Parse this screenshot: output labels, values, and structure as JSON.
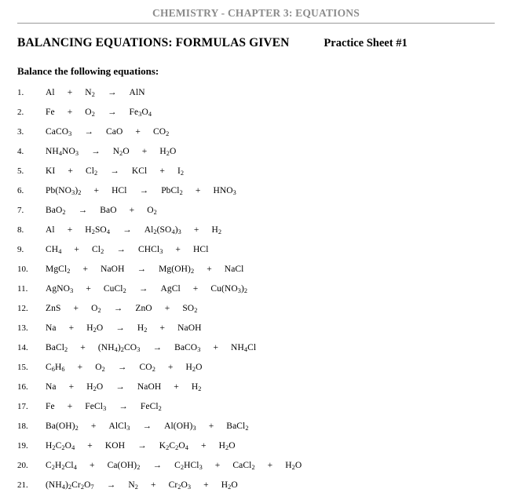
{
  "header": {
    "running_title": "CHEMISTRY - CHAPTER 3: EQUATIONS"
  },
  "title": {
    "main": "BALANCING EQUATIONS: FORMULAS GIVEN",
    "sheet": "Practice Sheet #1"
  },
  "instruction": "Balance the following equations:",
  "equations": [
    {
      "number": "1.",
      "reactants": [
        "Al",
        "N2"
      ],
      "products": [
        "AlN"
      ],
      "text": "Al  +  N2 →  AlN"
    },
    {
      "number": "2.",
      "reactants": [
        "Fe",
        "O2"
      ],
      "products": [
        "Fe3O4"
      ],
      "text": "Fe  +  O2  →  Fe3O4"
    },
    {
      "number": "3.",
      "reactants": [
        "CaCO3"
      ],
      "products": [
        "CaO",
        "CO2"
      ],
      "text": "CaCO3 →  CaO  +  CO2"
    },
    {
      "number": "4.",
      "reactants": [
        "NH4NO3"
      ],
      "products": [
        "N2O",
        "H2O"
      ],
      "text": "NH4NO3 →  N2O  +  H2O"
    },
    {
      "number": "5.",
      "reactants": [
        "KI",
        "Cl2"
      ],
      "products": [
        "KCl",
        "I2"
      ],
      "text": "KI  +  Cl2 →  KCl  +  I2"
    },
    {
      "number": "6.",
      "reactants": [
        "Pb(NO3)2",
        "HCl"
      ],
      "products": [
        "PbCl2",
        "HNO3"
      ],
      "text": "Pb(NO3)2 +  HCl →  PbCl2  +  HNO3"
    },
    {
      "number": "7.",
      "reactants": [
        "BaO2"
      ],
      "products": [
        "BaO",
        "O2"
      ],
      "text": "BaO2 →  BaO  +  O2"
    },
    {
      "number": "8.",
      "reactants": [
        "Al",
        "H2SO4"
      ],
      "products": [
        "Al2(SO4)3",
        "H2"
      ],
      "text": "Al  +  H2SO4 →  Al2(SO4)3  +  H2"
    },
    {
      "number": "9.",
      "reactants": [
        "CH4",
        "Cl2"
      ],
      "products": [
        "CHCl3",
        "HCl"
      ],
      "text": "CH4  +  Cl2 →  CHCl3  +  HCl"
    },
    {
      "number": "10.",
      "reactants": [
        "MgCl2",
        "NaOH"
      ],
      "products": [
        "Mg(OH)2",
        "NaCl"
      ],
      "text": "MgCl2  +  NaOH →  Mg(OH)2  +  NaCl"
    },
    {
      "number": "11.",
      "reactants": [
        "AgNO3",
        "CuCl2"
      ],
      "products": [
        "AgCl",
        "Cu(NO3)2"
      ],
      "text": "AgNO3  +  CuCl2 →  AgCl  +  Cu(NO3)2"
    },
    {
      "number": "12.",
      "reactants": [
        "ZnS",
        "O2"
      ],
      "products": [
        "ZnO",
        "SO2"
      ],
      "text": "ZnS  +  O2 →  ZnO  +  SO2"
    },
    {
      "number": "13.",
      "reactants": [
        "Na",
        "H2O"
      ],
      "products": [
        "H2",
        "NaOH"
      ],
      "text": "Na  +  H2O →  H2  +  NaOH"
    },
    {
      "number": "14.",
      "reactants": [
        "BaCl2",
        "(NH4)2CO3"
      ],
      "products": [
        "BaCO3",
        "NH4Cl"
      ],
      "text": "BaCl2  +  (NH4)2CO3 →  BaCO3  +  NH4Cl"
    },
    {
      "number": "15.",
      "reactants": [
        "C6H6",
        "O2"
      ],
      "products": [
        "CO2",
        "H2O"
      ],
      "text": "C6H6  +  O2 →  CO2  +  H2O"
    },
    {
      "number": "16.",
      "reactants": [
        "Na",
        "H2O"
      ],
      "products": [
        "NaOH",
        "H2"
      ],
      "text": "Na  +  H2O → NaOH  +  H2"
    },
    {
      "number": "17.",
      "reactants": [
        "Fe",
        "FeCl3"
      ],
      "products": [
        "FeCl2"
      ],
      "text": "Fe  +  FeCl3 →  FeCl2"
    },
    {
      "number": "18.",
      "reactants": [
        "Ba(OH)2",
        "AlCl3"
      ],
      "products": [
        "Al(OH)3",
        "BaCl2"
      ],
      "text": "Ba(OH)2  +  AlCl3 →  Al(OH)3  +  BaCl2"
    },
    {
      "number": "19.",
      "reactants": [
        "H2C2O4",
        "KOH"
      ],
      "products": [
        "K2C2O4",
        "H2O"
      ],
      "text": "H2C2O4  +  KOH →  K2C2O4  +  H2O"
    },
    {
      "number": "20.",
      "reactants": [
        "C2H2Cl4",
        "Ca(OH)2"
      ],
      "products": [
        "C2HCl3",
        "CaCl2",
        "H2O"
      ],
      "text": "C2H2Cl4  +  Ca(OH)2 →  C2HCl3  +  CaCl2  +  H2O"
    },
    {
      "number": "21.",
      "reactants": [
        "(NH4)2Cr2O7"
      ],
      "products": [
        "N2",
        "Cr2O3",
        "H2O"
      ],
      "text": "(NH4)2Cr2O7 →  N2  +  Cr2O3  +  H2O"
    }
  ],
  "colors": {
    "header_text": "#8a8a8a",
    "body_text": "#000000",
    "rule": "#9a9a9a",
    "page_background": "#ffffff"
  }
}
